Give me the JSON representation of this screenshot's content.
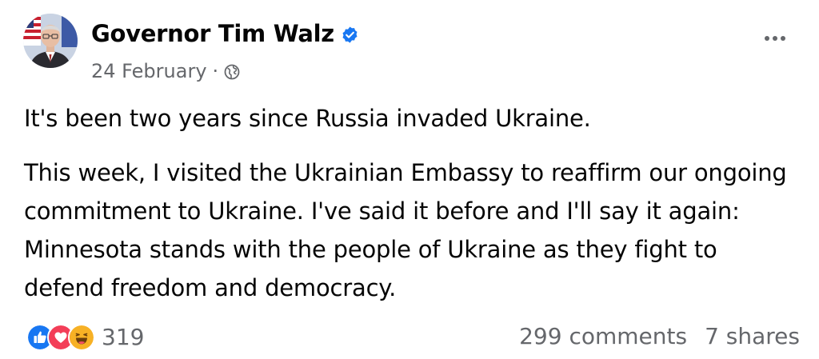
{
  "author": {
    "name": "Governor Tim Walz",
    "verified": true
  },
  "meta": {
    "date": "24 February",
    "separator": "·",
    "audience_icon": "globe-icon"
  },
  "menu": {
    "icon": "more-horizontal-icon"
  },
  "post": {
    "paragraphs": [
      "It's been two years since Russia invaded Ukraine.",
      "This week, I visited the Ukrainian Embassy to reaffirm our ongoing commitment to Ukraine. I've said it before and I'll say it again: Minnesota stands with the people of Ukraine as they fight to defend freedom and democracy."
    ]
  },
  "footer": {
    "reaction_icons": [
      "like-icon",
      "love-icon",
      "haha-icon"
    ],
    "reaction_count": "319",
    "comments": "299 comments",
    "shares": "7 shares"
  },
  "colors": {
    "like": "#1877f2",
    "love": "#f33e58",
    "haha": "#f7b125",
    "verified": "#1877f2",
    "secondary_text": "#65676b"
  }
}
